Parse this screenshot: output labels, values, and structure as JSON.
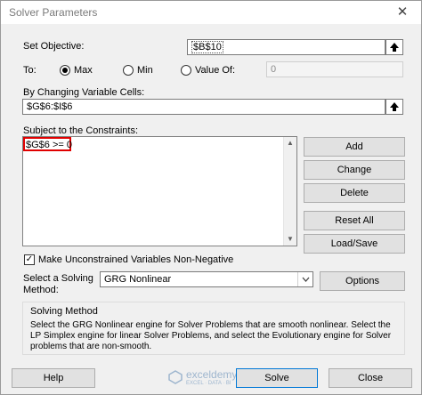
{
  "window": {
    "title": "Solver Parameters",
    "close_glyph": "✕"
  },
  "objective": {
    "label": "Set Objective:",
    "value": "$B$10"
  },
  "to": {
    "label": "To:",
    "max_label": "Max",
    "min_label": "Min",
    "value_of_label": "Value Of:",
    "value_of_value": "0",
    "selected": "Max"
  },
  "changing": {
    "label": "By Changing Variable Cells:",
    "value": "$G$6:$I$6"
  },
  "constraints": {
    "label": "Subject to the Constraints:",
    "items": [
      "$G$6 >= 0"
    ],
    "highlight_color": "#e00000"
  },
  "buttons": {
    "add": "Add",
    "change": "Change",
    "delete": "Delete",
    "reset_all": "Reset All",
    "load_save": "Load/Save",
    "options": "Options",
    "help": "Help",
    "solve": "Solve",
    "close": "Close"
  },
  "nonnegative": {
    "label": "Make Unconstrained Variables Non-Negative",
    "checked": true
  },
  "solving_method": {
    "label_line1": "Select a Solving",
    "label_line2": "Method:",
    "selected": "GRG Nonlinear"
  },
  "method_group": {
    "title": "Solving Method",
    "description": "Select the GRG Nonlinear engine for Solver Problems that are smooth nonlinear. Select the LP Simplex engine for linear Solver Problems, and select the Evolutionary engine for Solver problems that are non-smooth."
  },
  "watermark": {
    "name": "exceldemy",
    "tagline": "EXCEL · DATA · BI"
  },
  "icons": {
    "ref_button": "collapse-dialog-icon",
    "dropdown": "chevron-down-icon",
    "check": "checkmark-icon"
  }
}
